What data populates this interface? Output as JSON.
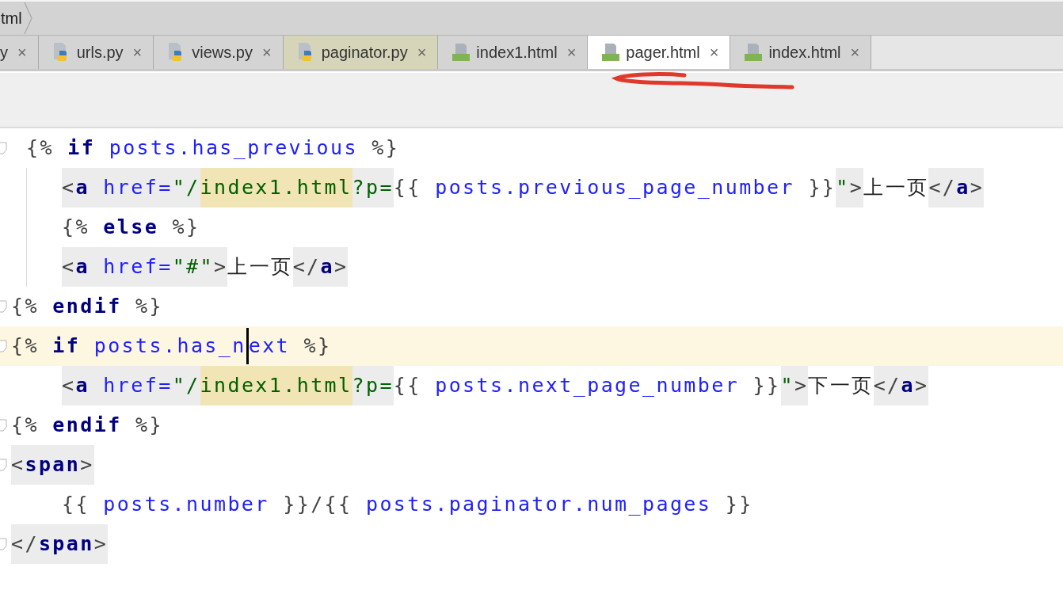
{
  "breadcrumb": "tml",
  "tabs": [
    {
      "label": "y",
      "kind": "python",
      "selected": false,
      "highlighted": false
    },
    {
      "label": "urls.py",
      "kind": "python",
      "selected": false,
      "highlighted": false
    },
    {
      "label": "views.py",
      "kind": "python",
      "selected": false,
      "highlighted": false
    },
    {
      "label": "paginator.py",
      "kind": "python",
      "selected": false,
      "highlighted": true
    },
    {
      "label": "index1.html",
      "kind": "html",
      "selected": false,
      "highlighted": false
    },
    {
      "label": "pager.html",
      "kind": "html",
      "selected": true,
      "highlighted": false
    },
    {
      "label": "index.html",
      "kind": "html",
      "selected": false,
      "highlighted": false
    }
  ],
  "close_glyph": "×",
  "code_lines": [
    {
      "kind": "opener",
      "fold": true,
      "guide": false,
      "current": false,
      "tokens": [
        {
          "kind": "delim",
          "text": "{% "
        },
        {
          "kind": "kw",
          "text": "if "
        },
        {
          "kind": "var",
          "text": "posts.has_previous"
        },
        {
          "kind": "delim",
          "text": " %}"
        }
      ]
    },
    {
      "kind": "inner",
      "fold": false,
      "guide": true,
      "current": false,
      "tokens": [
        {
          "kind": "punct",
          "text": "<"
        },
        {
          "kind": "tagname",
          "text": "a "
        },
        {
          "kind": "attr",
          "text": "href="
        },
        {
          "kind": "str",
          "text": "\"/"
        },
        {
          "kind": "strhl",
          "text": "index1.html"
        },
        {
          "kind": "str",
          "text": "?p="
        },
        {
          "kind": "delim",
          "text": "{{ "
        },
        {
          "kind": "var",
          "text": "posts.previous_page_number"
        },
        {
          "kind": "delim",
          "text": " }}"
        },
        {
          "kind": "str",
          "text": "\""
        },
        {
          "kind": "punct",
          "text": ">"
        },
        {
          "kind": "text",
          "text": "上一页"
        },
        {
          "kind": "punct",
          "text": "</"
        },
        {
          "kind": "tagname",
          "text": "a"
        },
        {
          "kind": "punct",
          "text": ">"
        }
      ]
    },
    {
      "kind": "inner",
      "fold": false,
      "guide": true,
      "current": false,
      "tokens": [
        {
          "kind": "delim",
          "text": "{% "
        },
        {
          "kind": "kw",
          "text": "else"
        },
        {
          "kind": "delim",
          "text": " %}"
        }
      ]
    },
    {
      "kind": "inner",
      "fold": false,
      "guide": true,
      "current": false,
      "tokens": [
        {
          "kind": "punct",
          "text": "<"
        },
        {
          "kind": "tagname",
          "text": "a "
        },
        {
          "kind": "attr",
          "text": "href="
        },
        {
          "kind": "str",
          "text": "\"#\""
        },
        {
          "kind": "punct",
          "text": ">"
        },
        {
          "kind": "text",
          "text": "上一页"
        },
        {
          "kind": "punct",
          "text": "</"
        },
        {
          "kind": "tagname",
          "text": "a"
        },
        {
          "kind": "punct",
          "text": ">"
        }
      ]
    },
    {
      "kind": "plain",
      "fold": true,
      "guide": false,
      "current": false,
      "tokens": [
        {
          "kind": "delim",
          "text": "{% "
        },
        {
          "kind": "kw",
          "text": "endif"
        },
        {
          "kind": "delim",
          "text": " %}"
        }
      ]
    },
    {
      "kind": "plain",
      "fold": true,
      "guide": false,
      "current": true,
      "tokens": [
        {
          "kind": "delim",
          "text": "{% "
        },
        {
          "kind": "kw",
          "text": "if "
        },
        {
          "kind": "var",
          "text": "posts.has_n"
        },
        {
          "kind": "caret"
        },
        {
          "kind": "var",
          "text": "ext"
        },
        {
          "kind": "delim",
          "text": " %}"
        }
      ]
    },
    {
      "kind": "inner",
      "fold": false,
      "guide": false,
      "current": false,
      "tokens": [
        {
          "kind": "punct",
          "text": "<"
        },
        {
          "kind": "tagname",
          "text": "a "
        },
        {
          "kind": "attr",
          "text": "href="
        },
        {
          "kind": "str",
          "text": "\"/"
        },
        {
          "kind": "strhl",
          "text": "index1.html"
        },
        {
          "kind": "str",
          "text": "?p="
        },
        {
          "kind": "delim",
          "text": "{{ "
        },
        {
          "kind": "var",
          "text": "posts.next_page_number"
        },
        {
          "kind": "delim",
          "text": " }}"
        },
        {
          "kind": "str",
          "text": "\""
        },
        {
          "kind": "punct",
          "text": ">"
        },
        {
          "kind": "text",
          "text": "下一页"
        },
        {
          "kind": "punct",
          "text": "</"
        },
        {
          "kind": "tagname",
          "text": "a"
        },
        {
          "kind": "punct",
          "text": ">"
        }
      ]
    },
    {
      "kind": "plain",
      "fold": true,
      "guide": false,
      "current": false,
      "tokens": [
        {
          "kind": "delim",
          "text": "{% "
        },
        {
          "kind": "kw",
          "text": "endif"
        },
        {
          "kind": "delim",
          "text": " %}"
        }
      ]
    },
    {
      "kind": "plain",
      "fold": true,
      "guide": false,
      "current": false,
      "tokens": [
        {
          "kind": "punct",
          "text": "<"
        },
        {
          "kind": "tagname",
          "text": "span"
        },
        {
          "kind": "punct",
          "text": ">"
        }
      ]
    },
    {
      "kind": "inner",
      "fold": false,
      "guide": false,
      "current": false,
      "tokens": [
        {
          "kind": "delim",
          "text": "{{ "
        },
        {
          "kind": "var",
          "text": "posts.number"
        },
        {
          "kind": "delim",
          "text": " }}/{{ "
        },
        {
          "kind": "var",
          "text": "posts.paginator.num_pages"
        },
        {
          "kind": "delim",
          "text": " }}"
        }
      ]
    },
    {
      "kind": "plain",
      "fold": true,
      "guide": false,
      "current": false,
      "tokens": [
        {
          "kind": "punct",
          "text": "</"
        },
        {
          "kind": "tagname",
          "text": "span"
        },
        {
          "kind": "punct",
          "text": ">"
        }
      ]
    }
  ]
}
